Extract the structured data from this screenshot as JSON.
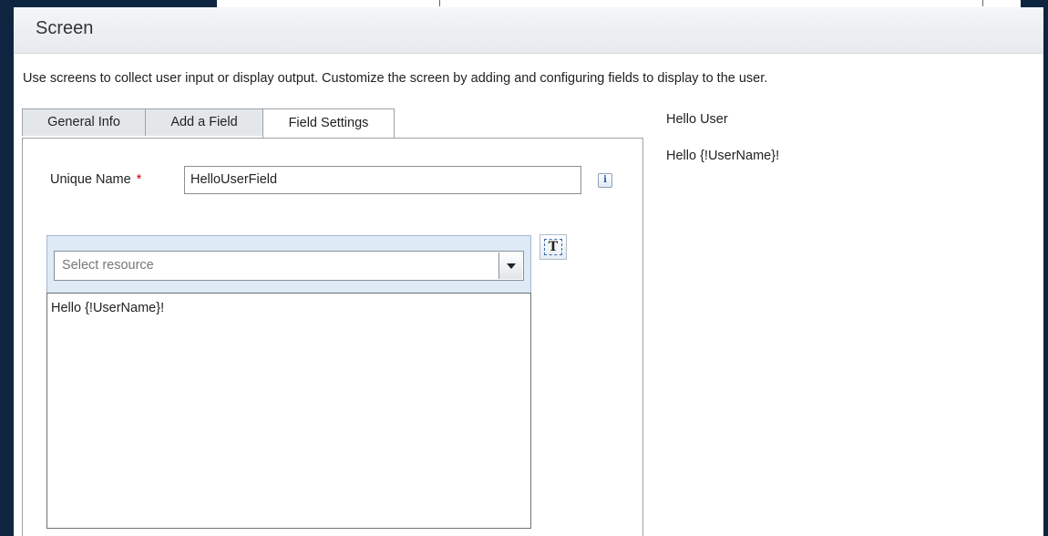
{
  "screen": {
    "title": "Screen",
    "description": "Use screens to collect user input or display output. Customize the screen by adding and configuring fields to display to the user."
  },
  "tabs": [
    {
      "label": "General Info",
      "active": false
    },
    {
      "label": "Add a Field",
      "active": false
    },
    {
      "label": "Field Settings",
      "active": true
    }
  ],
  "field_settings": {
    "unique_name_label": "Unique Name",
    "required_marker": "*",
    "unique_name_value": "HelloUserField",
    "info_icon_glyph": "i",
    "resource_select_placeholder": "Select resource",
    "text_icon_glyph": "T",
    "display_text": "Hello {!UserName}!"
  },
  "preview": {
    "title": "Hello User",
    "text": "Hello {!UserName}!"
  },
  "colors": {
    "background": "#0d2540",
    "header": "#e9edf1",
    "editor_bar": "#dfeaf7",
    "required": "#cc0000"
  }
}
